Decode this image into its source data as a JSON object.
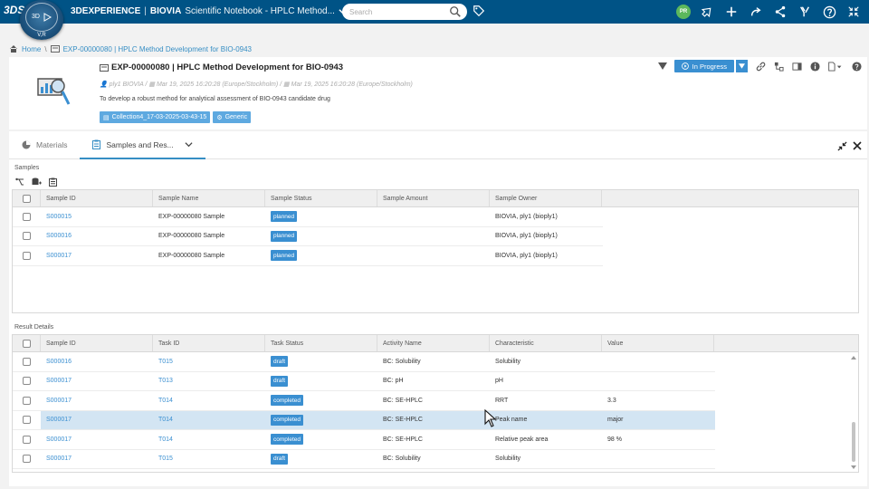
{
  "topbar": {
    "ds_logo": "3DS",
    "compass": {
      "left": "3D",
      "right": "V,R"
    },
    "brand": "3DEXPERIENCE",
    "separator": "|",
    "product": "BIOVIA",
    "app": "Scientific Notebook - HPLC Method...",
    "search_placeholder": "Search",
    "avatar_initials": "PR",
    "colors": {
      "bar": "#005386",
      "avatar": "#5cb85c"
    }
  },
  "breadcrumb": {
    "home": "Home",
    "separator": "\\",
    "current": "EXP-00000080 | HPLC Method Development for BIO-0943"
  },
  "experiment": {
    "title": "EXP-00000080 | HPLC Method Development for BIO-0943",
    "owner": "ply1 BIOVIA",
    "created": "Mar 19, 2025 16:20:28 (Europe/Stockholm)",
    "modified": "Mar 19, 2025 16:20:28 (Europe/Stockholm)",
    "description": "To develop a robust method for analytical assessment of BIO-0943 candidate drug",
    "chips": [
      "Collection4_17-03-2025-03-43-15",
      "Generic"
    ],
    "status": "In Progress"
  },
  "tabs": [
    {
      "label": "Materials"
    },
    {
      "label": "Samples and Res..."
    }
  ],
  "samples": {
    "label": "Samples",
    "columns": [
      "Sample ID",
      "Sample Name",
      "Sample Status",
      "Sample Amount",
      "Sample Owner"
    ],
    "rows": [
      {
        "id": "S000015",
        "name": "EXP-00000080 Sample",
        "status": "planned",
        "amount": "",
        "owner": "BIOVIA, ply1 (bioply1)"
      },
      {
        "id": "S000016",
        "name": "EXP-00000080 Sample",
        "status": "planned",
        "amount": "",
        "owner": "BIOVIA, ply1 (bioply1)"
      },
      {
        "id": "S000017",
        "name": "EXP-00000080 Sample",
        "status": "planned",
        "amount": "",
        "owner": "BIOVIA, ply1 (bioply1)"
      }
    ]
  },
  "results": {
    "label": "Result Details",
    "columns": [
      "Sample ID",
      "Task ID",
      "Task Status",
      "Activity Name",
      "Characteristic",
      "Value"
    ],
    "rows": [
      {
        "sample": "S000016",
        "task": "T015",
        "status": "draft",
        "activity": "BC: Solubility",
        "characteristic": "Solubility",
        "value": ""
      },
      {
        "sample": "S000017",
        "task": "T013",
        "status": "draft",
        "activity": "BC: pH",
        "characteristic": "pH",
        "value": ""
      },
      {
        "sample": "S000017",
        "task": "T014",
        "status": "completed",
        "activity": "BC: SE-HPLC",
        "characteristic": "RRT",
        "value": "3.3"
      },
      {
        "sample": "S000017",
        "task": "T014",
        "status": "completed",
        "activity": "BC: SE-HPLC",
        "characteristic": "Peak name",
        "value": "major"
      },
      {
        "sample": "S000017",
        "task": "T014",
        "status": "completed",
        "activity": "BC: SE-HPLC",
        "characteristic": "Relative peak area",
        "value": "98 %"
      },
      {
        "sample": "S000017",
        "task": "T015",
        "status": "draft",
        "activity": "BC: Solubility",
        "characteristic": "Solubility",
        "value": ""
      }
    ],
    "selected_row": 3
  }
}
